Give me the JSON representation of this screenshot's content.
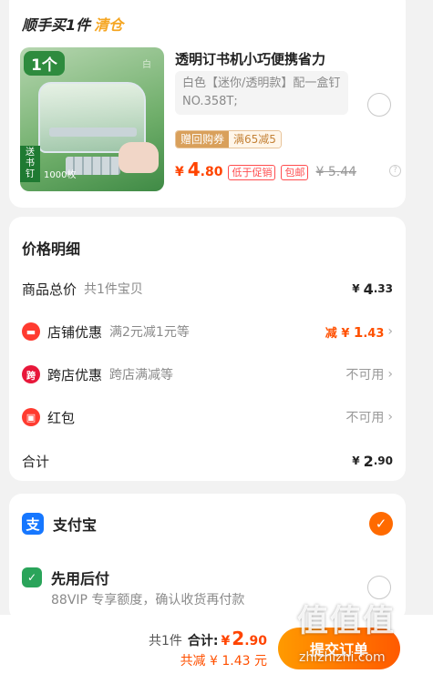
{
  "product_card": {
    "header_prefix": "顺手买1件",
    "header_highlight": "清仓",
    "image": {
      "qty_badge": "1个",
      "gift_badge": "送书钉",
      "gift_count": "1000枚",
      "brand_mark": "白"
    },
    "title": "透明订书机小巧便携省力",
    "spec": "白色【迷你/透明款】配一盒钉 NO.358T;",
    "coupon": {
      "left": "赠回购券",
      "right": "满65减5"
    },
    "price": {
      "currency": "¥",
      "int": "4",
      "dec": ".80",
      "tag1": "低于促销",
      "tag2": "包邮",
      "old": "¥ 5.44"
    },
    "help_glyph": "?"
  },
  "price_detail": {
    "title": "价格明细",
    "rows": [
      {
        "label": "商品总价",
        "sub": "共1件宝贝",
        "value_currency": "¥",
        "value_int": "4",
        "value_dec": ".33"
      },
      {
        "label": "店铺优惠",
        "sub": "满2元减1元等",
        "value_prefix": "减",
        "value_currency": "¥",
        "value_int": "1",
        "value_dec": ".43",
        "icon": "shop-discount-icon",
        "icon_glyph": "▬"
      },
      {
        "label": "跨店优惠",
        "sub": "跨店满减等",
        "value_text": "不可用",
        "icon": "cross-store-icon",
        "icon_glyph": "跨"
      },
      {
        "label": "红包",
        "value_text": "不可用",
        "icon": "red-packet-icon",
        "icon_glyph": "▣"
      },
      {
        "label": "合计",
        "value_currency": "¥",
        "value_int": "2",
        "value_dec": ".90"
      }
    ],
    "chevron": "›"
  },
  "payment": {
    "alipay_label": "支付宝",
    "alipay_glyph": "支",
    "check_glyph": "✓",
    "later_label": "先用后付",
    "later_glyph": "✓",
    "later_sub": "88VIP 专享额度，确认收货再付款"
  },
  "bottom_bar": {
    "count": "共1件",
    "total_label": "合计:",
    "total_currency": "¥",
    "total_int": "2",
    "total_dec": ".90",
    "saved": "共减 ¥ 1.43 元",
    "submit": "提交订单"
  },
  "watermark": {
    "big": "值值值",
    "small": "zhizhizhi.com"
  },
  "colors": {
    "accent": "#ff5000",
    "price": "#ff4400",
    "alipay": "#1677ff",
    "later_green": "#2aa45a",
    "clearance": "#f5a623"
  }
}
